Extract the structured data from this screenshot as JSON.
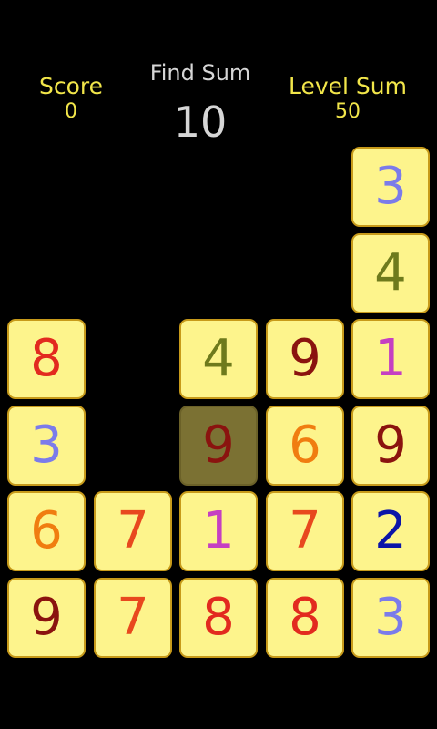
{
  "hud": {
    "score_label": "Score",
    "score_value": "0",
    "find_label": "Find Sum",
    "find_value": "10",
    "level_label": "Level Sum",
    "level_value": "50"
  },
  "colors": {
    "1": "#c53fc2",
    "2": "#0b14a8",
    "3": "#7b7bea",
    "4": "#6e7a1c",
    "6": "#f07d10",
    "7": "#e8481e",
    "8": "#e22a1f",
    "9": "#8a130f"
  },
  "board": {
    "columns": 5,
    "rows": 6,
    "tiles": [
      {
        "col": 4,
        "row": 0,
        "value": "3",
        "selected": false
      },
      {
        "col": 4,
        "row": 1,
        "value": "4",
        "selected": false
      },
      {
        "col": 0,
        "row": 2,
        "value": "8",
        "selected": false
      },
      {
        "col": 2,
        "row": 2,
        "value": "4",
        "selected": false
      },
      {
        "col": 3,
        "row": 2,
        "value": "9",
        "selected": false
      },
      {
        "col": 4,
        "row": 2,
        "value": "1",
        "selected": false
      },
      {
        "col": 0,
        "row": 3,
        "value": "3",
        "selected": false
      },
      {
        "col": 2,
        "row": 3,
        "value": "9",
        "selected": true
      },
      {
        "col": 3,
        "row": 3,
        "value": "6",
        "selected": false
      },
      {
        "col": 4,
        "row": 3,
        "value": "9",
        "selected": false
      },
      {
        "col": 0,
        "row": 4,
        "value": "6",
        "selected": false
      },
      {
        "col": 1,
        "row": 4,
        "value": "7",
        "selected": false
      },
      {
        "col": 2,
        "row": 4,
        "value": "1",
        "selected": false
      },
      {
        "col": 3,
        "row": 4,
        "value": "7",
        "selected": false
      },
      {
        "col": 4,
        "row": 4,
        "value": "2",
        "selected": false
      },
      {
        "col": 0,
        "row": 5,
        "value": "9",
        "selected": false
      },
      {
        "col": 1,
        "row": 5,
        "value": "7",
        "selected": false
      },
      {
        "col": 2,
        "row": 5,
        "value": "8",
        "selected": false
      },
      {
        "col": 3,
        "row": 5,
        "value": "8",
        "selected": false
      },
      {
        "col": 4,
        "row": 5,
        "value": "3",
        "selected": false
      }
    ]
  }
}
